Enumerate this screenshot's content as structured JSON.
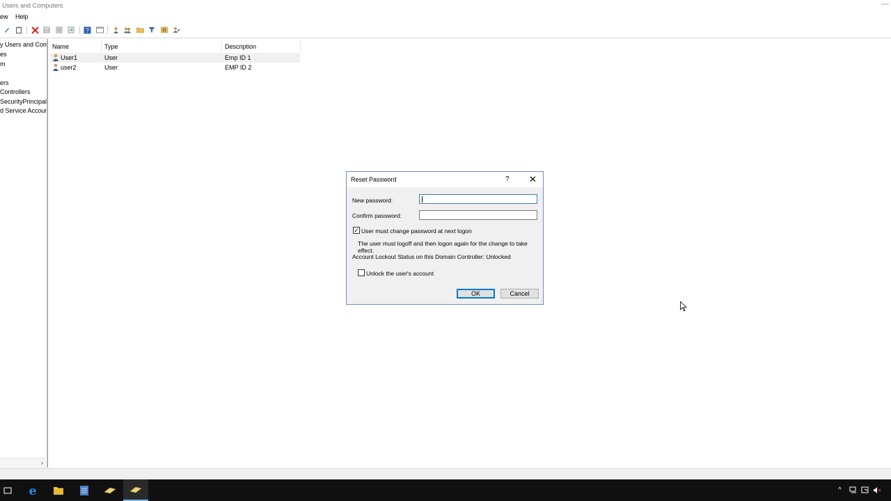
{
  "window": {
    "title": "Users and Computers"
  },
  "menu": {
    "view_label": "ew",
    "help_label": "Help"
  },
  "toolbar": {
    "icons": [
      "properties-icon",
      "clipboard-icon",
      "delete-icon",
      "grid-icon",
      "refresh-icon",
      "export-icon",
      "help-icon",
      "console-icon",
      "add-user-icon",
      "add-group-icon",
      "add-ou-icon",
      "filter-icon",
      "find-icon",
      "delegate-icon"
    ]
  },
  "tree": {
    "items": [
      "y Users and Com",
      "es",
      "m",
      "",
      "ers",
      " Controllers",
      "SecurityPrincipals",
      "d Service Accoun"
    ]
  },
  "list": {
    "columns": [
      "Name",
      "Type",
      "Description"
    ],
    "rows": [
      {
        "name": "User1",
        "type": "User",
        "description": "Emp ID 1"
      },
      {
        "name": "user2",
        "type": "User",
        "description": "EMP ID 2"
      }
    ]
  },
  "dialog": {
    "title": "Reset Password",
    "help_glyph": "?",
    "close_glyph": "✕",
    "new_password_label": "New password:",
    "new_password_value": "",
    "confirm_password_label": "Confirm password:",
    "confirm_password_value": "",
    "must_change_label": "User must change password at next logon",
    "must_change_checked": true,
    "info_text": "The user must logoff and then logon again for the change to take effect.",
    "lockout_status": "Account Lockout Status on this Domain Controller: Unlocked",
    "unlock_label": "Unlock the user's account",
    "unlock_checked": false,
    "ok_label": "OK",
    "cancel_label": "Cancel"
  },
  "taskbar": {
    "items": [
      "task-view-icon",
      "internet-explorer-icon",
      "file-explorer-icon",
      "server-manager-icon",
      "ad-users-computers-icon",
      "ad-users-computers-active-icon"
    ]
  }
}
